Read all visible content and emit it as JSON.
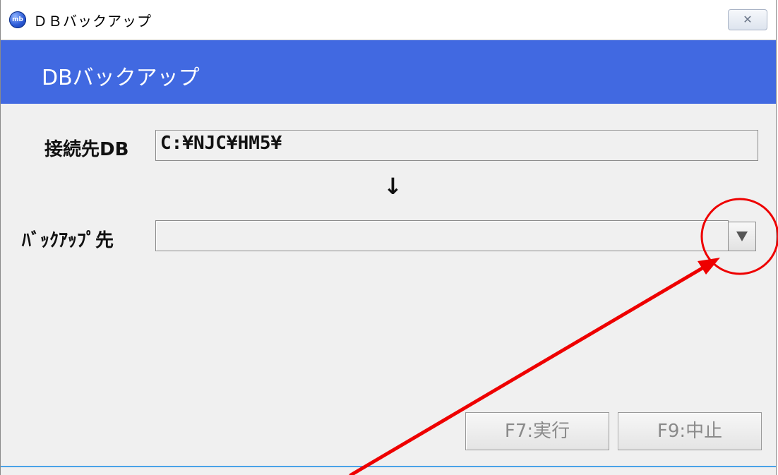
{
  "window": {
    "title": "ＤＢバックアップ",
    "app_icon_text": "mb",
    "close_glyph": "✕"
  },
  "header": {
    "title": "DBバックアップ"
  },
  "form": {
    "source_label": "接続先DB",
    "source_value": "C:¥NJC¥HM5¥",
    "direction_glyph": "↓",
    "dest_label": "ﾊﾞｯｸｱｯﾌﾟ先",
    "dest_value": ""
  },
  "buttons": {
    "execute_label": "F7:実行",
    "cancel_label": "F9:中止"
  },
  "colors": {
    "header_band": "#4169e1",
    "annotation": "#ee0000"
  }
}
